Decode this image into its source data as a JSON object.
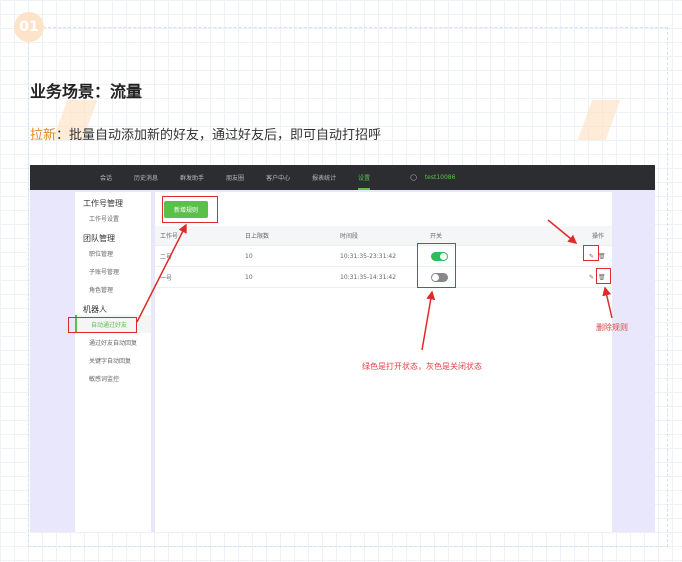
{
  "badge": "01",
  "title": "业务场景：流量",
  "subtitle": {
    "key": "拉新",
    "text": "：批量自动添加新的好友，通过好友后，即可自动打招呼"
  },
  "nav": {
    "items": [
      "会话",
      "历史消息",
      "群发助手",
      "朋友圈",
      "客户中心",
      "报表统计",
      "设置"
    ],
    "active": "设置",
    "user": "test10086"
  },
  "sidebar": {
    "groups": [
      {
        "label": "工作号管理",
        "items": [
          "工作号设置"
        ]
      },
      {
        "label": "团队管理",
        "items": [
          "职位管理",
          "子账号管理",
          "角色管理"
        ]
      },
      {
        "label": "机器人",
        "items": [
          "自动通过好友",
          "通过好友自动回复",
          "关键字自动回复",
          "敏感词监控"
        ]
      }
    ],
    "active": "自动通过好友"
  },
  "main": {
    "add_button": "新增规则",
    "columns": [
      "工作号",
      "日上限数",
      "时间段",
      "开关",
      "操作"
    ],
    "rows": [
      {
        "account": "二号",
        "limit": "10",
        "time": "10:31:35-23:31:42",
        "on": true
      },
      {
        "account": "一号",
        "limit": "10",
        "time": "10:31:35-14:31:42",
        "on": false
      }
    ]
  },
  "annotations": {
    "switch_note": "绿色是打开状态，灰色是关闭状态",
    "delete_note": "删除规则"
  },
  "colors": {
    "accent": "#5ac04a",
    "annotation": "#e02a2a",
    "orange": "#e0862a"
  }
}
